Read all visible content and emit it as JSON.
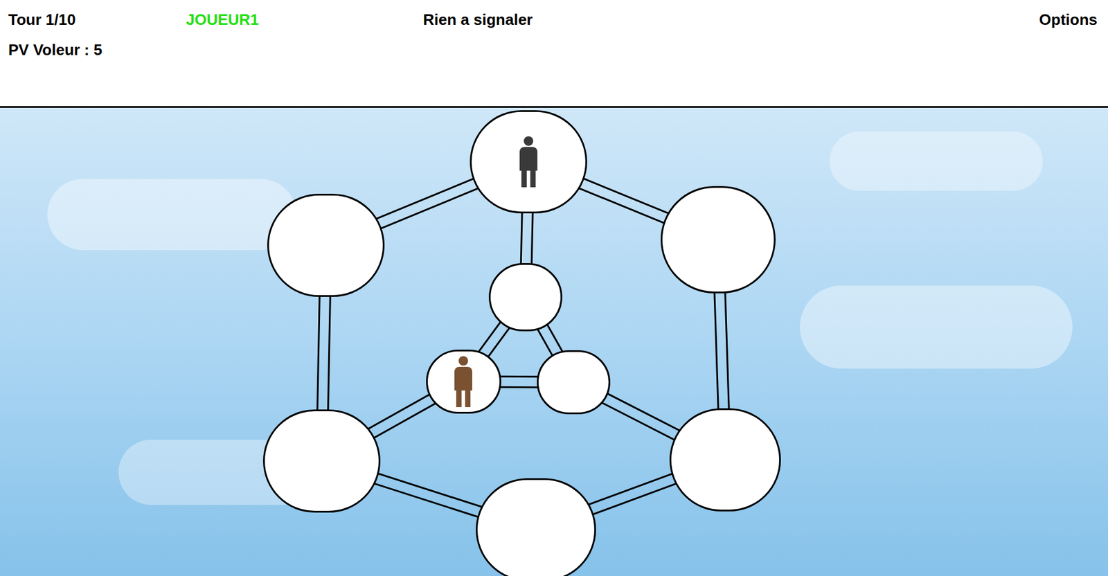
{
  "header": {
    "turn": "Tour 1/10",
    "player": "JOUEUR1",
    "message": "Rien a signaler",
    "options": "Options",
    "thief_hp": "PV Voleur : 5"
  },
  "board": {
    "nodes": [
      {
        "occupied": true,
        "token_color": "#3a3a3a"
      },
      {
        "occupied": false,
        "token_color": "#000000"
      },
      {
        "occupied": false,
        "token_color": "#000000"
      },
      {
        "occupied": false,
        "token_color": "#000000"
      },
      {
        "occupied": true,
        "token_color": "#7a5232"
      },
      {
        "occupied": false,
        "token_color": "#000000"
      },
      {
        "occupied": false,
        "token_color": "#000000"
      },
      {
        "occupied": false,
        "token_color": "#000000"
      },
      {
        "occupied": false,
        "token_color": "#000000"
      }
    ],
    "edges": [
      [
        0,
        1
      ],
      [
        0,
        2
      ],
      [
        1,
        6
      ],
      [
        2,
        7
      ],
      [
        6,
        8
      ],
      [
        7,
        8
      ],
      [
        0,
        3
      ],
      [
        3,
        4
      ],
      [
        3,
        5
      ],
      [
        4,
        5
      ],
      [
        4,
        6
      ],
      [
        5,
        7
      ]
    ]
  }
}
